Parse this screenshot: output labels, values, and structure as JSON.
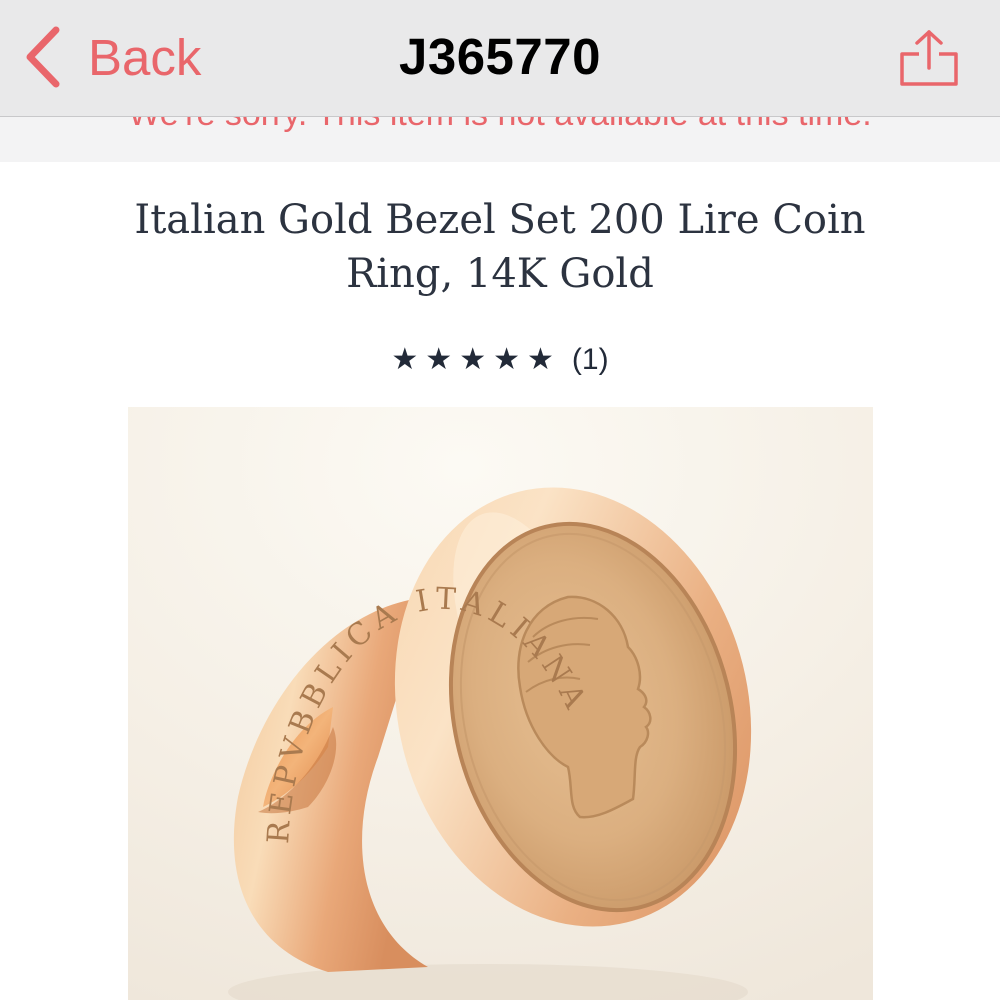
{
  "nav": {
    "back_label": "Back",
    "title": "J365770",
    "back_icon": "chevron-left-icon",
    "share_icon": "share-icon"
  },
  "banner": {
    "message": "We're sorry. This item is not available at this time."
  },
  "product": {
    "title": "Italian Gold Bezel Set 200 Lire Coin Ring, 14K Gold",
    "rating": {
      "stars": 5,
      "max_stars": 5,
      "count_label": "(1)"
    },
    "coin_inscription": "REPVBBLICA ITALIANA",
    "image_description": "gold-coin-ring-photo"
  },
  "colors": {
    "accent": "#e9666b",
    "navbar_bg": "#e9e9ea",
    "title_text": "#2c3340",
    "star": "#222a38"
  }
}
